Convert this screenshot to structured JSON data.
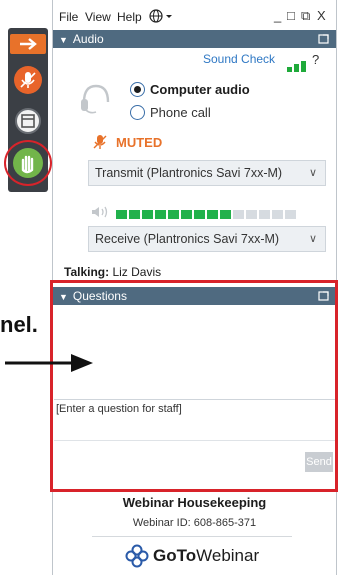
{
  "menu": {
    "file": "File",
    "view": "View",
    "help": "Help",
    "globe_icon": "globe-icon"
  },
  "window_controls": {
    "minimize": "_",
    "restore": "□",
    "restore2": "⧉",
    "close": "X"
  },
  "audio": {
    "panel_title": "Audio",
    "sound_check": "Sound Check",
    "help_mark": "?",
    "computer_audio": "Computer audio",
    "phone_call": "Phone call",
    "selected_mode": "Computer audio",
    "muted_label": "MUTED",
    "transmit_device": "Transmit (Plantronics Savi 7xx-M)",
    "receive_device": "Receive (Plantronics Savi 7xx-M)",
    "level_segments_total": 14,
    "level_segments_on": 9
  },
  "talking": {
    "label": "Talking:",
    "name": "Liz Davis"
  },
  "questions": {
    "panel_title": "Questions",
    "input_placeholder": "[Enter a question for staff]",
    "send_label": "Send"
  },
  "annotation": {
    "text": "nel."
  },
  "footer": {
    "title": "Webinar Housekeeping",
    "webinar_id": "Webinar ID: 608-865-371",
    "brand_bold": "GoTo",
    "brand_regular": "Webinar"
  },
  "colors": {
    "panel_header": "#4f6a80",
    "muted_orange": "#e8722a",
    "meter_green": "#22b14c",
    "highlight_red": "#d8232a"
  }
}
